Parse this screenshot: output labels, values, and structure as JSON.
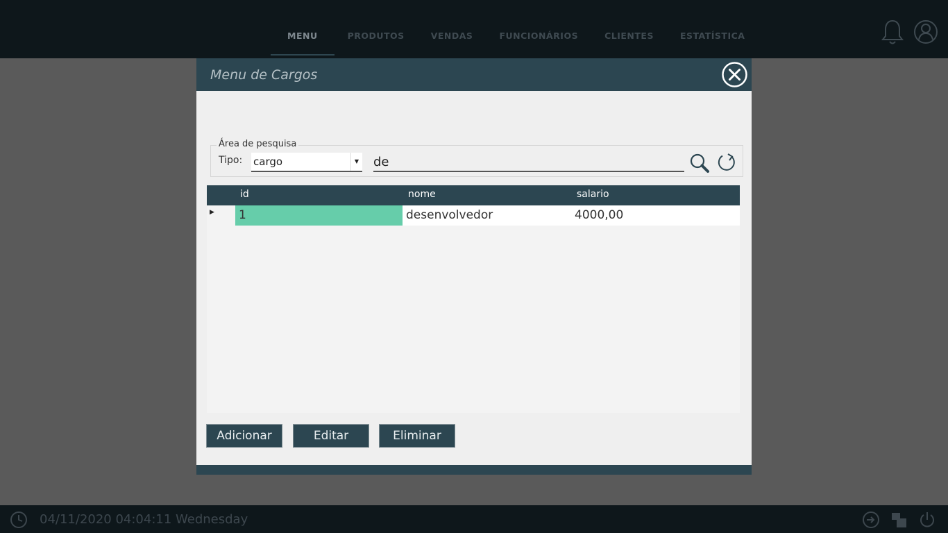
{
  "nav": {
    "items": [
      {
        "label": "MENU",
        "active": true
      },
      {
        "label": "PRODUTOS",
        "active": false
      },
      {
        "label": "VENDAS",
        "active": false
      },
      {
        "label": "FUNCIONÁRIOS",
        "active": false
      },
      {
        "label": "CLIENTES",
        "active": false
      },
      {
        "label": "ESTATÍSTICA",
        "active": false
      }
    ],
    "icons": [
      "bell-icon",
      "user-icon"
    ]
  },
  "dialog": {
    "title": "Menu de Cargos",
    "search": {
      "legend": "Área de pesquisa",
      "tipo_label": "Tipo:",
      "tipo_value": "cargo",
      "query": "de"
    },
    "grid": {
      "columns": [
        "id",
        "nome",
        "salario"
      ],
      "rows": [
        {
          "id": "1",
          "nome": "desenvolvedor",
          "salario": "4000,00"
        }
      ]
    },
    "buttons": {
      "add": "Adicionar",
      "edit": "Editar",
      "delete": "Eliminar"
    }
  },
  "statusbar": {
    "datetime": "04/11/2020 04:04:11  Wednesday"
  },
  "colors": {
    "header": "#2c4651",
    "selected_cell": "#66cdaa",
    "topbar": "#0e171b"
  }
}
